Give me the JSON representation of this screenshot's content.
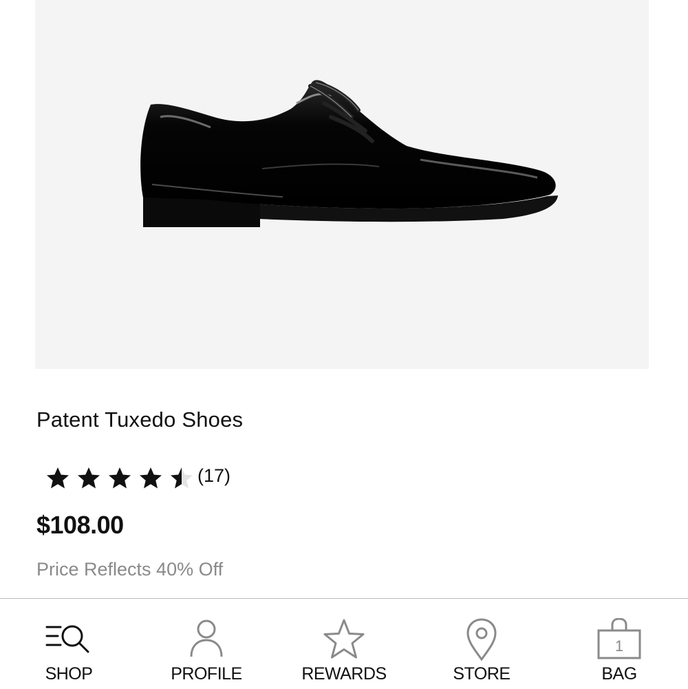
{
  "product": {
    "title": "Patent Tuxedo Shoes",
    "rating": 4.5,
    "rating_max": 5,
    "review_count": "(17)",
    "price": "$108.00",
    "discount_note": "Price Reflects 40% Off"
  },
  "colors": {
    "image_background": "#f4f4f4",
    "star_fill": "#111111",
    "muted_text": "#8a8a8a",
    "active_nav_icon": "#111111",
    "inactive_nav_icon": "#8a8a8a"
  },
  "bottom_nav": {
    "shop": {
      "label": "SHOP",
      "icon": "search-menu-icon",
      "active": true
    },
    "profile": {
      "label": "PROFILE",
      "icon": "person-icon"
    },
    "rewards": {
      "label": "REWARDS",
      "icon": "star-outline-icon"
    },
    "store": {
      "label": "STORE",
      "icon": "map-pin-icon"
    },
    "bag": {
      "label": "BAG",
      "icon": "shopping-bag-icon",
      "count": "1"
    }
  }
}
